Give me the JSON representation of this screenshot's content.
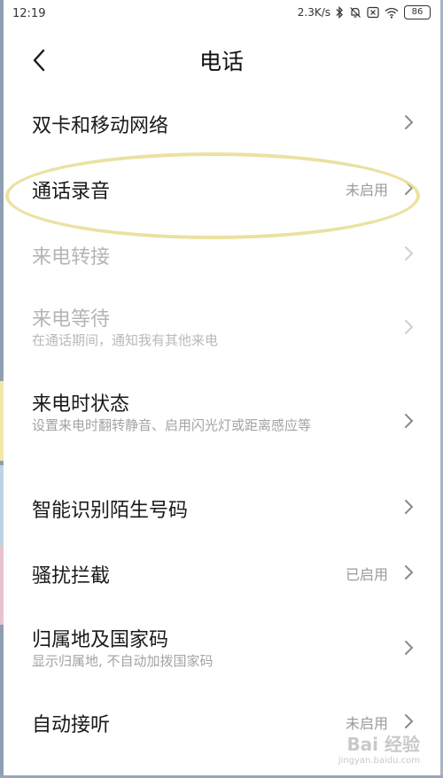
{
  "status_bar": {
    "time": "12:19",
    "net_speed": "2.3K/s",
    "battery": "86",
    "icons": [
      "bluetooth-icon",
      "mute-icon",
      "sim-icon",
      "wifi-icon",
      "battery-icon"
    ]
  },
  "header": {
    "title": "电话",
    "back_icon": "back-arrow-icon"
  },
  "items": [
    {
      "title": "双卡和移动网络",
      "subtitle": "",
      "value": "",
      "enabled": true
    },
    {
      "title": "通话录音",
      "subtitle": "",
      "value": "未启用",
      "enabled": true
    },
    {
      "title": "来电转接",
      "subtitle": "",
      "value": "",
      "enabled": false
    },
    {
      "title": "来电等待",
      "subtitle": "在通话期间，通知我有其他来电",
      "value": "",
      "enabled": false
    },
    {
      "title": "来电时状态",
      "subtitle": "设置来电时翻转静音、启用闪光灯或距离感应等",
      "value": "",
      "enabled": true
    },
    {
      "title": "智能识别陌生号码",
      "subtitle": "",
      "value": "",
      "enabled": true
    },
    {
      "title": "骚扰拦截",
      "subtitle": "",
      "value": "已启用",
      "enabled": true
    },
    {
      "title": "归属地及国家码",
      "subtitle": "显示归属地, 不自动加拨国家码",
      "value": "",
      "enabled": true
    },
    {
      "title": "自动接听",
      "subtitle": "",
      "value": "未启用",
      "enabled": true
    }
  ],
  "watermark": {
    "main": "Bai 经验",
    "sub": "jingyan.baidu.com"
  },
  "colors": {
    "highlight": "#eadf9c",
    "disabled_text": "#b5b5b5",
    "secondary_text": "#a3a3a3"
  }
}
